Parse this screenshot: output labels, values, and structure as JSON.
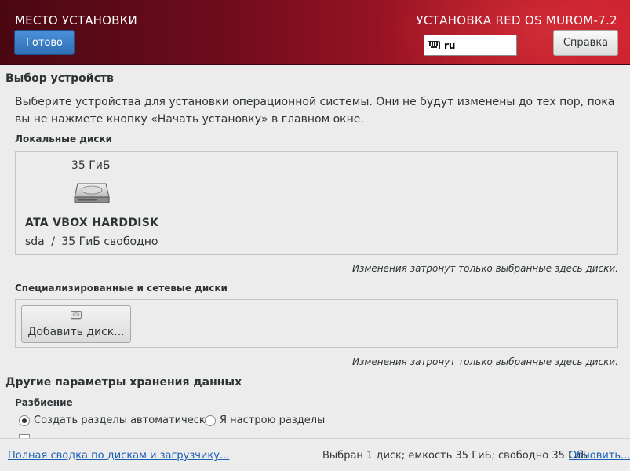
{
  "header": {
    "spoke_title": "МЕСТО УСТАНОВКИ",
    "done_label": "Готово",
    "product_title": "УСТАНОВКА RED OS MUROM-7.2",
    "keyboard_layout": "ru",
    "help_label": "Справка"
  },
  "device_selection": {
    "title": "Выбор устройств",
    "description": "Выберите устройства для установки операционной системы. Они не будут изменены до тех пор, пока вы не нажмете кнопку «Начать установку» в главном окне.",
    "local_disks_title": "Локальные диски",
    "disk": {
      "size": "35 ГиБ",
      "name": "ATA VBOX HARDDISK",
      "device": "sda",
      "separator": "/",
      "free": "35 ГиБ свободно"
    },
    "local_note": "Изменения затронут только выбранные здесь диски.",
    "specialized_title": "Специализированные и сетевые диски",
    "add_disk_label": "Добавить диск...",
    "specialized_note": "Изменения затронут только выбранные здесь диски."
  },
  "other_storage": {
    "title": "Другие параметры хранения данных",
    "partitioning_title": "Разбиение",
    "auto_option": "Создать разделы автоматически",
    "manual_option": "Я настрою разделы",
    "selected": "auto"
  },
  "footer": {
    "summary_link": "Полная сводка по дискам и загрузчику...",
    "status": "Выбран 1 диск; емкость 35 ГиБ; свободно 35 ГиБ",
    "refresh_link": "Обновить..."
  },
  "colors": {
    "header_dark": "#4a0812",
    "header_light": "#c81c2a",
    "done_button": "#3b7fc8",
    "link": "#1b5fb5"
  }
}
